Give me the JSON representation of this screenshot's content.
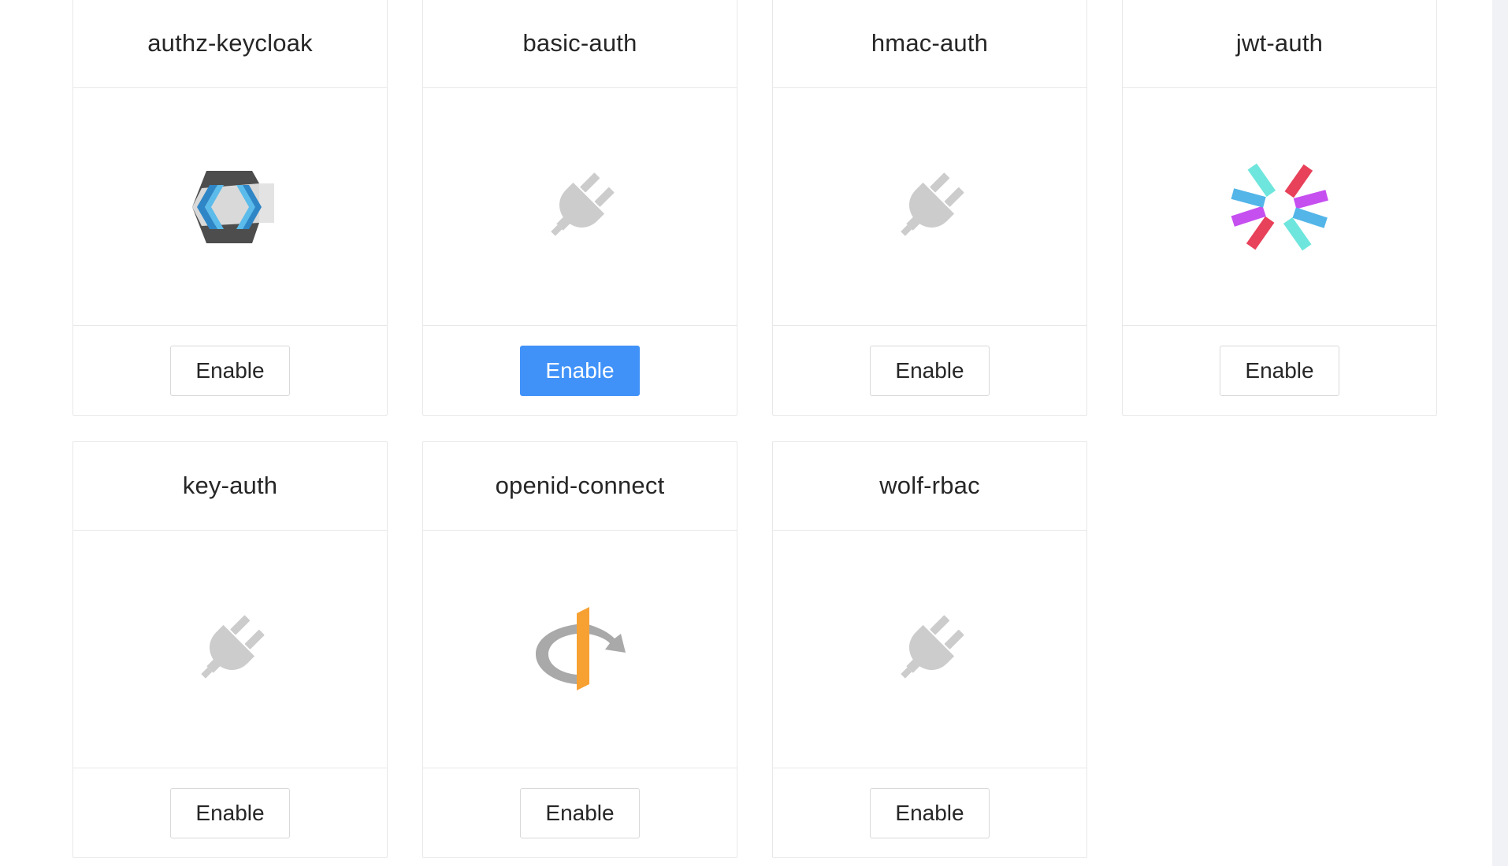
{
  "plugins": [
    {
      "name": "authz-keycloak",
      "icon": "keycloak-logo-icon",
      "button": "Enable",
      "button_state": "default"
    },
    {
      "name": "basic-auth",
      "icon": "plug-icon",
      "button": "Enable",
      "button_state": "primary"
    },
    {
      "name": "hmac-auth",
      "icon": "plug-icon",
      "button": "Enable",
      "button_state": "default"
    },
    {
      "name": "jwt-auth",
      "icon": "jwt-logo-icon",
      "button": "Enable",
      "button_state": "default"
    },
    {
      "name": "key-auth",
      "icon": "plug-icon",
      "button": "Enable",
      "button_state": "default"
    },
    {
      "name": "openid-connect",
      "icon": "openid-logo-icon",
      "button": "Enable",
      "button_state": "default"
    },
    {
      "name": "wolf-rbac",
      "icon": "plug-icon",
      "button": "Enable",
      "button_state": "default"
    }
  ],
  "colors": {
    "primary_button": "#4092f9",
    "plug_icon": "#cccccc",
    "keycloak_dark": "#4d4d4d",
    "keycloak_blue": "#4aa8df",
    "jwt_cyan": "#6ee6dd",
    "jwt_pink": "#e8415a",
    "jwt_purple": "#c64ff0",
    "jwt_blue": "#53b5e8",
    "openid_orange": "#f7a133",
    "openid_gray": "#b0b0b0"
  }
}
